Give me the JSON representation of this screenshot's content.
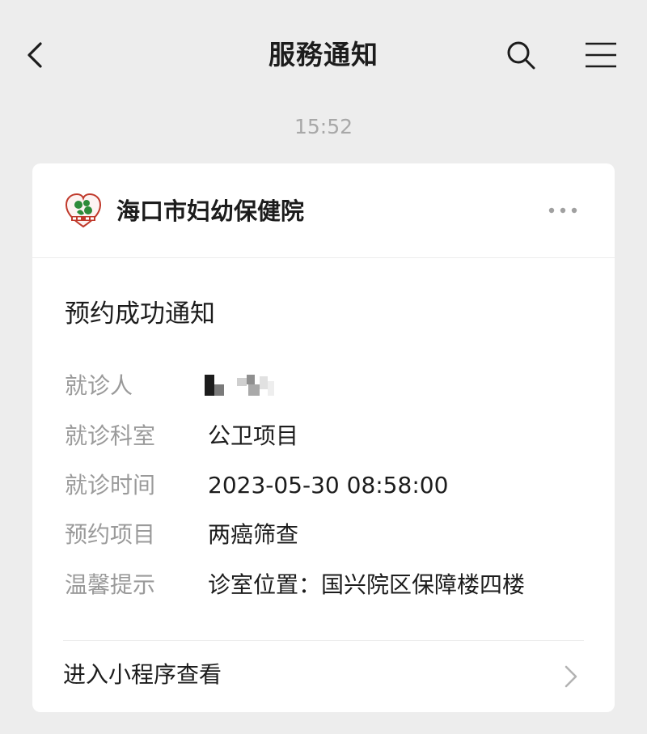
{
  "nav": {
    "title": "服務通知",
    "icons": [
      "chevron-left-icon",
      "search-icon",
      "menu-icon"
    ]
  },
  "timestamp": "15:52",
  "card": {
    "org_name": "海口市妇幼保健院",
    "logo_icon": "hospital-logo-icon",
    "more_icon": "more-dots-icon",
    "title": "预约成功通知",
    "fields": [
      {
        "label": "就诊人",
        "value": ""
      },
      {
        "label": "就诊科室",
        "value": "公卫项目"
      },
      {
        "label": "就诊时间",
        "value": "2023-05-30 08:58:00"
      },
      {
        "label": "预约项目",
        "value": "两癌筛查"
      },
      {
        "label": "温馨提示",
        "value": "诊室位置：国兴院区保障楼四楼"
      }
    ],
    "footer_link": "进入小程序查看",
    "footer_icon": "chevron-right-icon"
  },
  "colors": {
    "background": "#ededed",
    "card": "#ffffff",
    "label": "#9a9a9a",
    "timestamp": "#a8a8a8",
    "logo_green": "#2e8b3a",
    "logo_red": "#c0392b"
  }
}
